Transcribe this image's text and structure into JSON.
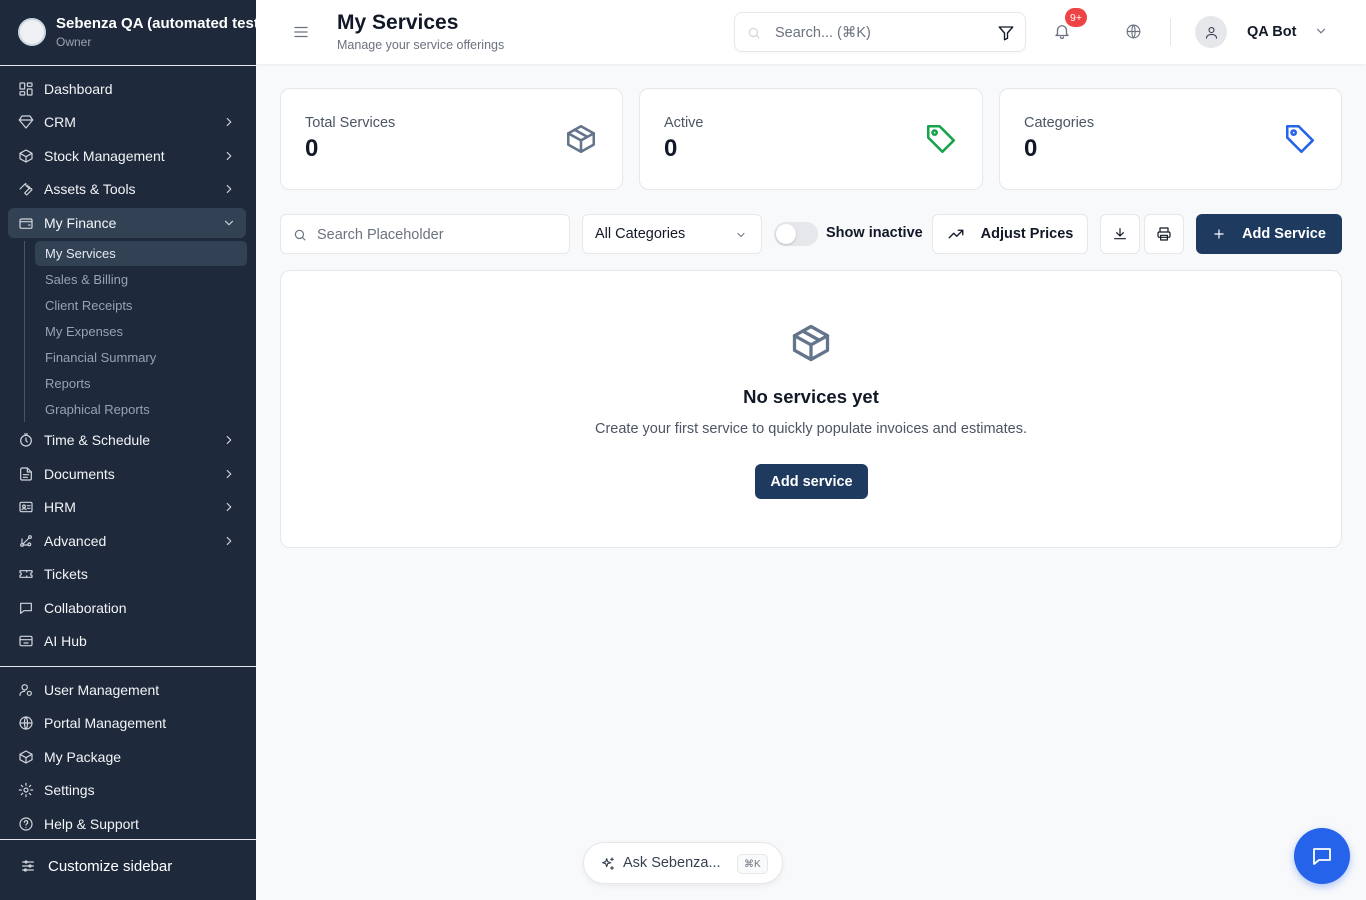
{
  "org": {
    "name": "Sebenza QA (automated tests)",
    "role": "Owner"
  },
  "sidebar": {
    "items": [
      {
        "label": "Dashboard",
        "icon": "dashboard-icon",
        "has_children": false
      },
      {
        "label": "CRM",
        "icon": "diamond-icon",
        "has_children": true
      },
      {
        "label": "Stock Management",
        "icon": "package-icon",
        "has_children": true
      },
      {
        "label": "Assets & Tools",
        "icon": "wrench-icon",
        "has_children": true
      },
      {
        "label": "My Finance",
        "icon": "wallet-icon",
        "has_children": true,
        "expanded": true
      },
      {
        "label": "Time & Schedule",
        "icon": "clock-icon",
        "has_children": true
      },
      {
        "label": "Documents",
        "icon": "document-icon",
        "has_children": true
      },
      {
        "label": "HRM",
        "icon": "people-icon",
        "has_children": true
      },
      {
        "label": "Advanced",
        "icon": "advanced-icon",
        "has_children": true
      },
      {
        "label": "Tickets",
        "icon": "ticket-icon",
        "has_children": false
      },
      {
        "label": "Collaboration",
        "icon": "chat-icon",
        "has_children": false
      },
      {
        "label": "AI Hub",
        "icon": "ai-hub-icon",
        "has_children": false
      }
    ],
    "finance_sub": [
      "My Services",
      "Sales & Billing",
      "Client Receipts",
      "My Expenses",
      "Financial Summary",
      "Reports",
      "Graphical Reports"
    ],
    "active_sub": "My Services",
    "bottom_items": [
      {
        "label": "User Management",
        "icon": "user-cog-icon"
      },
      {
        "label": "Portal Management",
        "icon": "globe-icon"
      },
      {
        "label": "My Package",
        "icon": "package-icon"
      },
      {
        "label": "Settings",
        "icon": "gear-icon"
      },
      {
        "label": "Help & Support",
        "icon": "help-icon"
      }
    ],
    "customize": "Customize sidebar"
  },
  "header": {
    "title": "My Services",
    "subtitle": "Manage your service offerings",
    "search_placeholder": "Search... (⌘K)",
    "notification_badge": "9+",
    "user_name": "QA Bot"
  },
  "stats": [
    {
      "label": "Total Services",
      "value": "0",
      "icon": "box-icon",
      "color": "#64748b"
    },
    {
      "label": "Active",
      "value": "0",
      "icon": "tag-icon",
      "color": "#16a34a"
    },
    {
      "label": "Categories",
      "value": "0",
      "icon": "tag-icon",
      "color": "#2563eb"
    }
  ],
  "toolbar": {
    "search_placeholder": "Search Placeholder",
    "category_selected": "All Categories",
    "show_inactive_label": "Show inactive",
    "show_inactive_on": false,
    "adjust_prices_label": "Adjust Prices",
    "add_service_label": "Add Service"
  },
  "empty": {
    "title": "No services yet",
    "description": "Create your first service to quickly populate invoices and estimates.",
    "button": "Add service"
  },
  "ask": {
    "label": "Ask Sebenza...",
    "shortcut": "⌘K"
  },
  "colors": {
    "sidebar_bg": "#1e293b",
    "primary": "#1e3a5f",
    "chat_button": "#2563eb",
    "badge": "#ef4444"
  }
}
